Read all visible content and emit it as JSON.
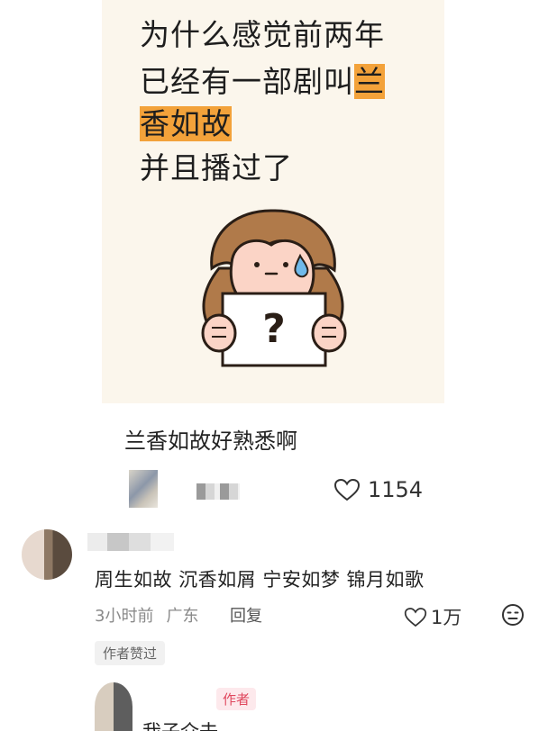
{
  "post": {
    "image_text": {
      "line1": "为什么感觉前两年",
      "line2_plain": "已经有一部剧叫",
      "line2_highlight": "兰",
      "line3_highlight": "香如故",
      "line4": "并且播过了"
    },
    "illustration_icon": "confused-girl-holding-question-sign",
    "title": "兰香如故好熟悉啊",
    "like_count": "1154",
    "highlight_color": "#f3a23a"
  },
  "comment": {
    "text": "周生如故 沉香如屑 宁安如梦 锦月如歌",
    "time": "3小时前",
    "location": "广东",
    "reply_label": "回复",
    "like_count": "1万",
    "author_liked_label": "作者赞过"
  },
  "reply": {
    "author_badge": "作者",
    "text": "我子介去"
  }
}
